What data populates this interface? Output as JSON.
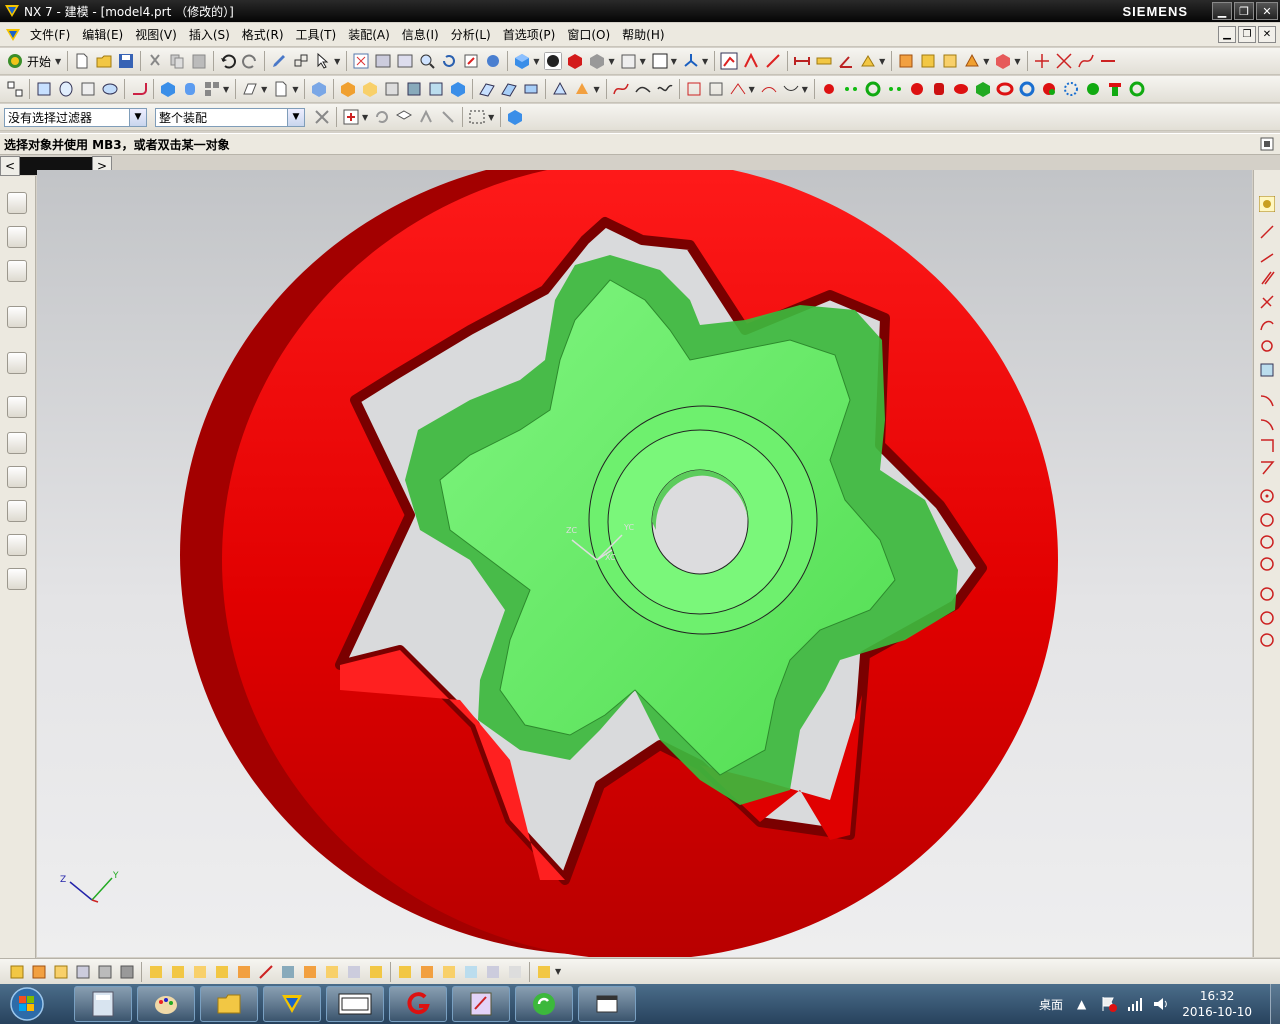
{
  "window": {
    "title": "NX 7 - 建模 - [model4.prt （修改的）]",
    "brand": "SIEMENS",
    "minimize_icon": "minimize-icon",
    "restore_icon": "restore-icon",
    "close_icon": "close-icon"
  },
  "menubar": {
    "items": [
      "文件(F)",
      "编辑(E)",
      "视图(V)",
      "插入(S)",
      "格式(R)",
      "工具(T)",
      "装配(A)",
      "信息(I)",
      "分析(L)",
      "首选项(P)",
      "窗口(O)",
      "帮助(H)"
    ]
  },
  "toolbar1": {
    "start_label": "开始"
  },
  "selection_bar": {
    "filter_value": "没有选择过滤器",
    "scope_value": "整个装配"
  },
  "cue_line": {
    "text": "选择对象并使用 MB3，或者双击某一对象"
  },
  "navigator": {
    "back_label": "<",
    "forward_label": ">"
  },
  "viewport": {
    "wcs_labels": {
      "xc": "XC",
      "yc": "YC",
      "zc": "ZC"
    },
    "triad_labels": {
      "z": "Z",
      "y": "Y"
    },
    "colors": {
      "outer_body": "#e40000",
      "outer_shade": "#a80000",
      "gear": "#66ee66",
      "gear_dark": "#33b833",
      "background_top": "#c2c4c7",
      "background_bottom": "#eeeeef"
    }
  },
  "taskbar": {
    "desktop_label": "桌面",
    "time": "16:32",
    "date": "2016-10-10",
    "apps": [
      "calculator-icon",
      "paint-icon",
      "explorer-folder-icon",
      "nx-icon",
      "ggg-icon",
      "g-red-icon",
      "document-icon",
      "refresh-green-icon",
      "window-icon"
    ]
  }
}
